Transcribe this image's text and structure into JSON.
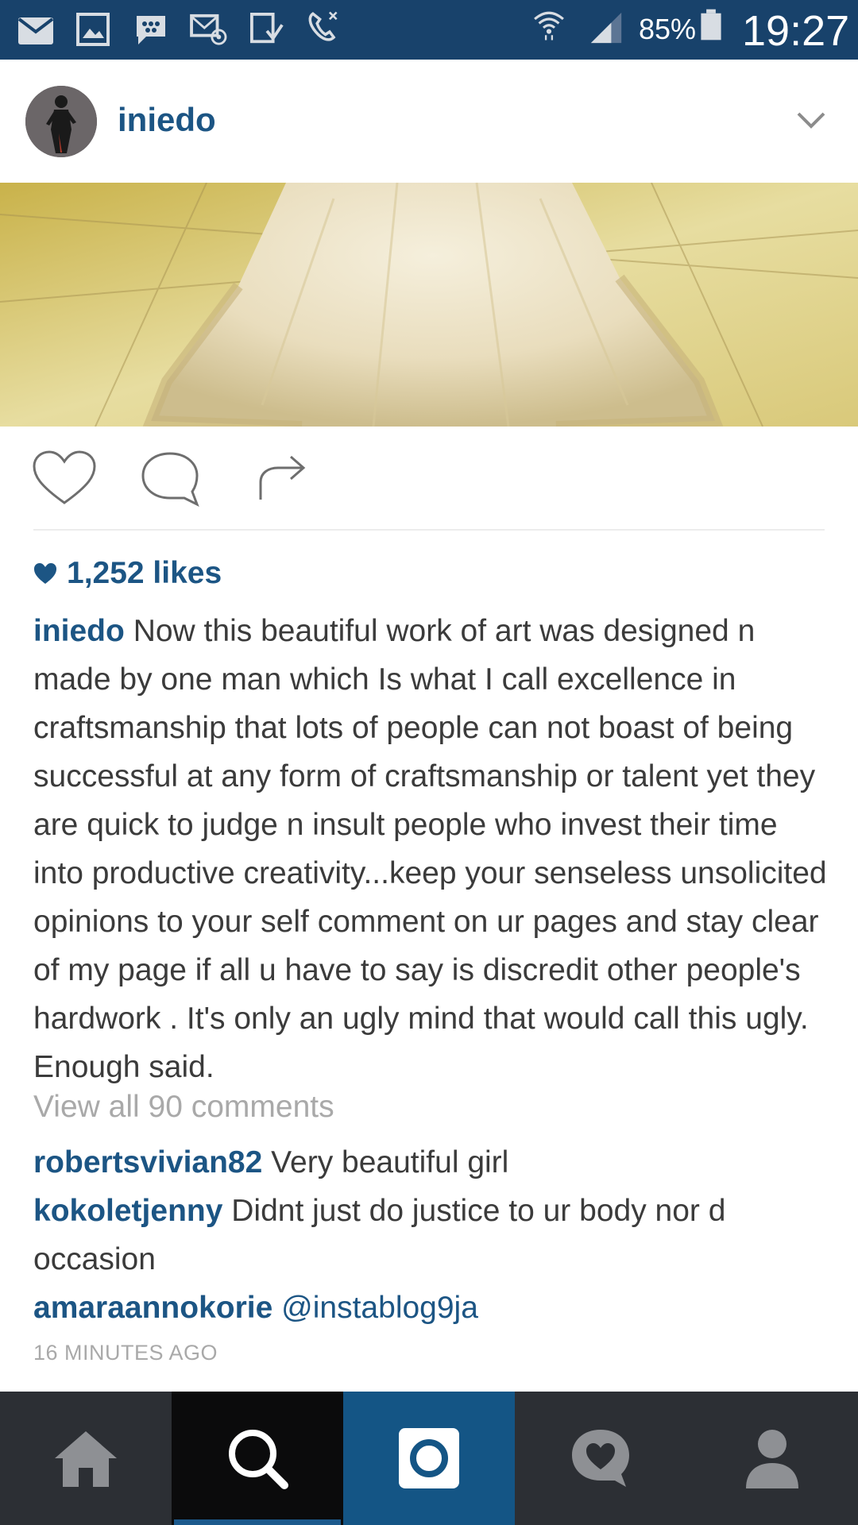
{
  "status_bar": {
    "battery_percent": "85%",
    "time": "19:27",
    "icons": [
      "mail-icon",
      "gallery-icon",
      "bbm-icon",
      "email-at-icon",
      "download-icon",
      "missed-call-icon",
      "wifi-icon",
      "signal-icon",
      "battery-icon"
    ]
  },
  "post": {
    "username": "iniedo",
    "likes": "1,252 likes",
    "caption_username": "iniedo",
    "caption_text": "Now this beautiful work of art was designed n made by one man which Is what I call excellence in craftsmanship that lots of people can not boast of being successful at any form of craftsmanship or talent yet they are quick to judge n insult people who invest their time into productive creativity...keep your senseless unsolicited opinions to your self comment on ur pages and stay clear of my page if all u have to say is discredit other people's hardwork . It's only an ugly mind that would call this ugly. Enough said.",
    "view_all_comments": "View all 90 comments",
    "comments": [
      {
        "user": "robertsvivian82",
        "text": "Very beautiful girl"
      },
      {
        "user": "kokoletjenny",
        "text": "Didnt just do justice to ur body nor d occasion"
      },
      {
        "user": "amaraannokorie",
        "text": "@instablog9ja"
      }
    ],
    "timestamp": "16 MINUTES AGO"
  },
  "nav": {
    "tabs": [
      "home",
      "search",
      "camera",
      "activity",
      "profile"
    ],
    "active": "search"
  },
  "colors": {
    "status_bar": "#18426b",
    "accent": "#1c5584",
    "nav_bg": "#2c2f34",
    "nav_camera": "#145585"
  }
}
